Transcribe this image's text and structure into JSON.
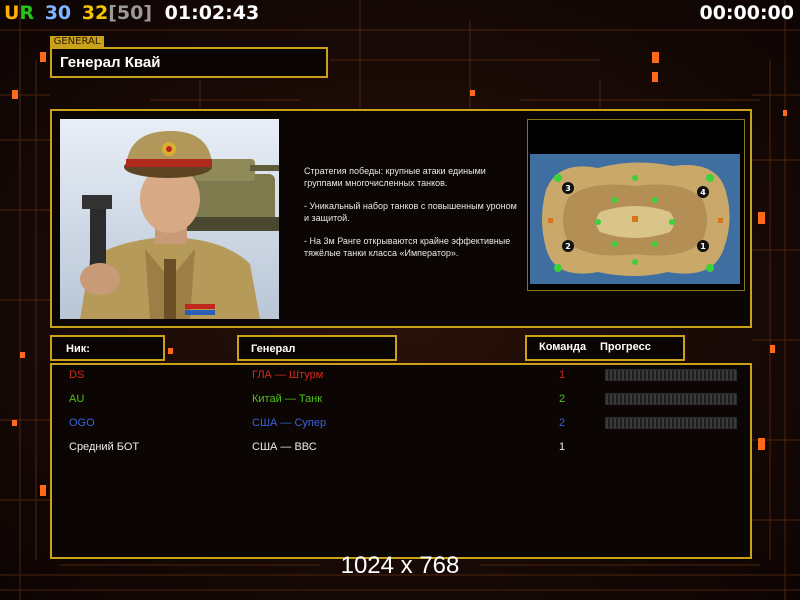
{
  "hud": {
    "ur_label": "UR",
    "fps_a": "30",
    "fps_b": "32",
    "fps_limit": "[50]",
    "clock": "01:02:43",
    "game_timer": "00:00:00"
  },
  "general": {
    "tag": "GENERAL",
    "name": "Генерал Квай"
  },
  "description": [
    "Стратегия победы: крупные атаки едиными группами многочисленных танков.",
    "- Уникальный набор танков с повышенным уроном и защитой.",
    "- На 3м Ранге открываются крайне эффективные тяжёлые танки класса «Император»."
  ],
  "map": {
    "start_positions": [
      "1",
      "2",
      "3",
      "4"
    ]
  },
  "table": {
    "headers": {
      "nick": "Ник:",
      "general": "Генерал",
      "team": "Команда",
      "progress": "Прогресс"
    },
    "players": [
      {
        "nick": "DS",
        "general": "ГЛА — Штурм",
        "team": "1",
        "color": "#d42b1c",
        "progress": 0,
        "show_progress": true
      },
      {
        "nick": "AU",
        "general": "Китай — Танк",
        "team": "2",
        "color": "#4fc21f",
        "progress": 0,
        "show_progress": true
      },
      {
        "nick": "OGO",
        "general": "США — Супер",
        "team": "2",
        "color": "#3c63d6",
        "progress": 0,
        "show_progress": true
      },
      {
        "nick": "Средний БОТ",
        "general": "США — ВВС",
        "team": "1",
        "color": "#ececec",
        "progress": null,
        "show_progress": false
      }
    ]
  },
  "resolution_text": "1024 x 768",
  "colors": {
    "frame": "#c9a21a",
    "ur_u": "#ffb000",
    "ur_r": "#26c41a",
    "fps_a": "#7fb6ff",
    "fps_b": "#f5c400",
    "fps_limit": "#9a9a9a"
  }
}
